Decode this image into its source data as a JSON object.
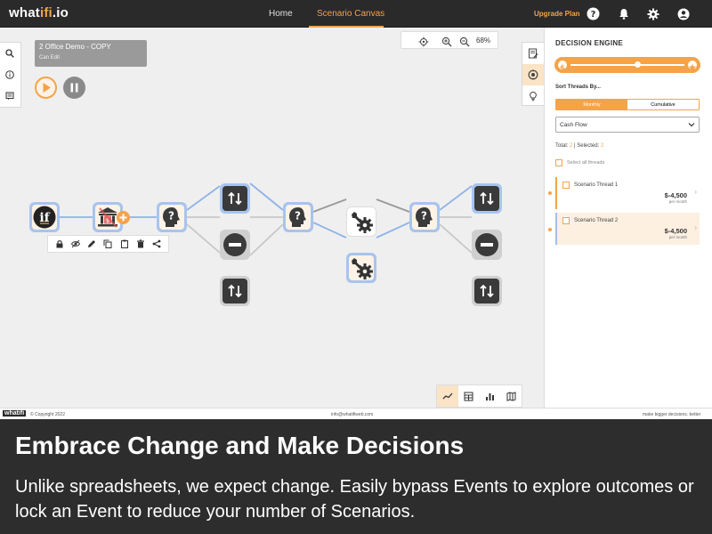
{
  "app": {
    "logo_main": "what",
    "logo_accent": "ifi",
    "logo_tail": ".io"
  },
  "nav": {
    "home": "Home",
    "scenario_canvas": "Scenario Canvas",
    "upgrade": "Upgrade Plan"
  },
  "canvas": {
    "scenario_title": "2 Office Demo - COPY",
    "scenario_subtitle": "Can Edit",
    "zoom_level": "68%"
  },
  "panel": {
    "title": "DECISION ENGINE",
    "sort_label": "Sort Threads By...",
    "sort_options": [
      "Monthly",
      "Cumulative"
    ],
    "metric_value": "Cash Flow",
    "total_label": "Total:",
    "total_value": "2",
    "selected_label": "| Selected:",
    "selected_value": "2",
    "select_all": "Select all threads",
    "threads": [
      {
        "name": "Scenario Thread 1",
        "amount": "$-4,500",
        "period": "per month"
      },
      {
        "name": "Scenario Thread 2",
        "amount": "$-4,500",
        "period": "per month"
      }
    ]
  },
  "footer": {
    "logo": "whatifi",
    "copyright": "© Copyright 2022",
    "email": "info@whatifiweb.com",
    "tagline": "make bigger decisions. better"
  },
  "caption": {
    "title": "Embrace Change and Make Decisions",
    "body": "Unlike spreadsheets, we expect change. Easily bypass Events to explore outcomes or lock an Event to reduce your number of Scenarios."
  },
  "colors": {
    "accent": "#f5a349",
    "node_blue": "#a8c4ee",
    "node_dark": "#3a3a3a",
    "topbar": "#2a2a2a"
  }
}
